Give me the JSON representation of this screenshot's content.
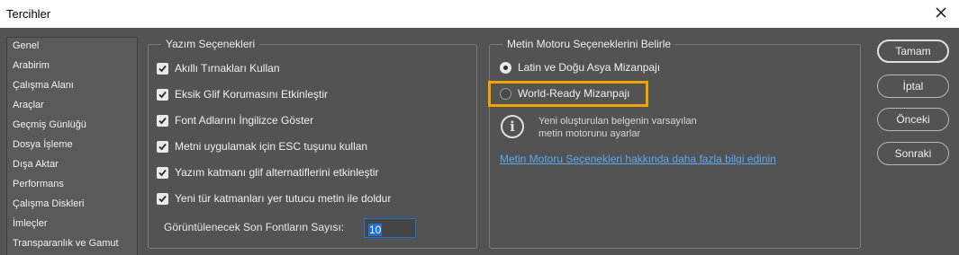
{
  "window": {
    "title": "Tercihler"
  },
  "sidebar": {
    "items": [
      {
        "label": "Genel"
      },
      {
        "label": "Arabirim"
      },
      {
        "label": "Çalışma Alanı"
      },
      {
        "label": "Araçlar"
      },
      {
        "label": "Geçmiş Günlüğü"
      },
      {
        "label": "Dosya İşleme"
      },
      {
        "label": "Dışa Aktar"
      },
      {
        "label": "Performans"
      },
      {
        "label": "Çalışma Diskleri"
      },
      {
        "label": "İmleçler"
      },
      {
        "label": "Transparanlık ve Gamut"
      }
    ]
  },
  "type_options": {
    "legend": "Yazım Seçenekleri",
    "checkboxes": [
      {
        "label": "Akıllı Tırnakları Kullan",
        "checked": true
      },
      {
        "label": "Eksik Glif Korumasını Etkinleştir",
        "checked": true
      },
      {
        "label": "Font Adlarını İngilizce Göster",
        "checked": true
      },
      {
        "label": "Metni uygulamak için ESC tuşunu kullan",
        "checked": true
      },
      {
        "label": "Yazım katmanı glif alternatiflerini etkinleştir",
        "checked": true
      },
      {
        "label": "Yeni tür katmanları yer tutucu metin ile doldur",
        "checked": true
      }
    ],
    "recent_fonts_label": "Görüntülenecek Son Fontların Sayısı:",
    "recent_fonts_value": "10"
  },
  "text_engine": {
    "legend": "Metin Motoru Seçeneklerini Belirle",
    "options": [
      {
        "label": "Latin ve Doğu Asya Mizanpajı",
        "selected": true
      },
      {
        "label": "World-Ready Mizanpajı",
        "selected": false
      }
    ],
    "info_icon": "info-icon",
    "info_line1": "Yeni oluşturulan belgenin varsayılan",
    "info_line2": "metin motorunu ayarlar",
    "link": "Metin Motoru Seçenekleri hakkında daha fazla bilgi edinin"
  },
  "buttons": {
    "ok": "Tamam",
    "cancel": "İptal",
    "previous": "Önceki",
    "next": "Sonraki"
  },
  "colors": {
    "background": "#535353",
    "highlight": "#f0a400",
    "link": "#5aa9f5"
  }
}
